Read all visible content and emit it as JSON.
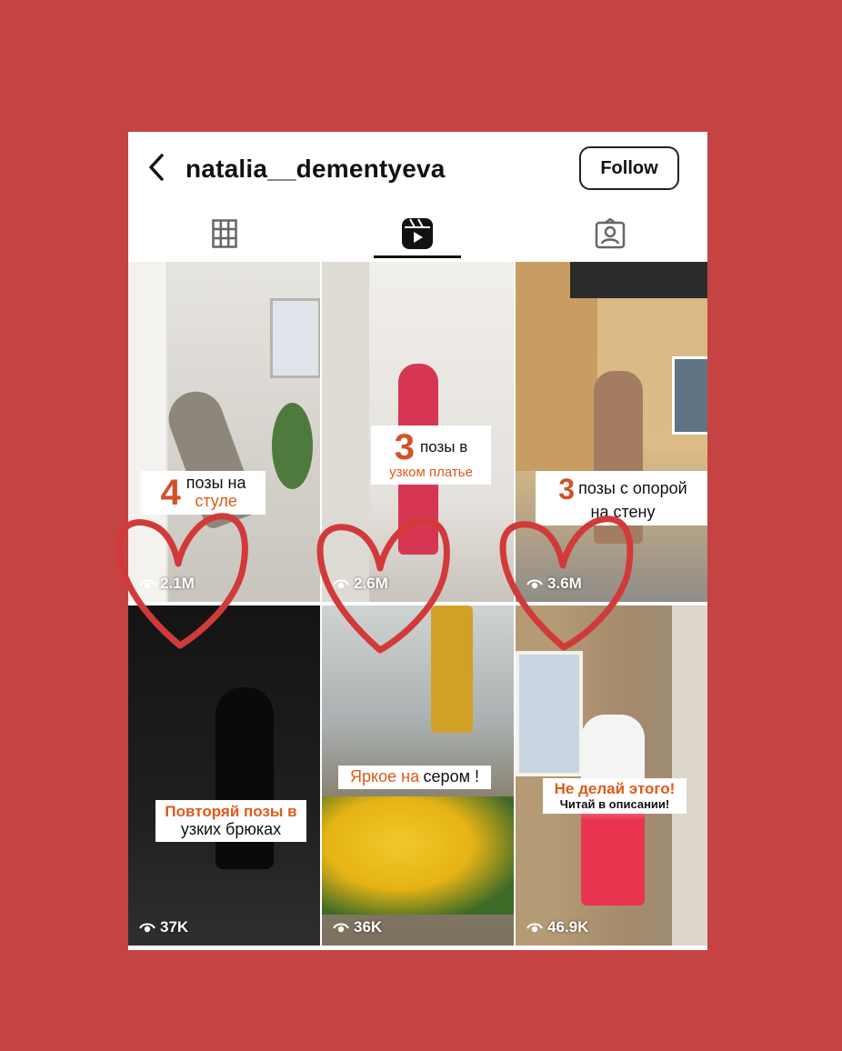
{
  "header": {
    "username": "natalia__dementyeva",
    "follow_label": "Follow"
  },
  "tabs": [
    {
      "name": "grid",
      "icon": "grid-icon"
    },
    {
      "name": "reels",
      "icon": "reels-icon",
      "active": true
    },
    {
      "name": "tagged",
      "icon": "tagged-person-icon"
    }
  ],
  "reels": [
    {
      "views": "2.1M",
      "caption_num": "4",
      "caption_line1": "позы на",
      "caption_line2": "стуле"
    },
    {
      "views": "2.6M",
      "caption_num": "3",
      "caption_line1": "позы в",
      "caption_line2": "узком платье"
    },
    {
      "views": "3.6M",
      "caption_num": "3",
      "caption_line1": "позы с опорой",
      "caption_line2": "на стену"
    },
    {
      "views": "37K",
      "caption_line1": "Повторяй позы в",
      "caption_line2": "узких брюках"
    },
    {
      "views": "36K",
      "caption_line1": "Яркое на",
      "caption_line2": "сером !"
    },
    {
      "views": "46.9K",
      "caption_line1": "Не делай этого!",
      "caption_line2": "Читай в описании!"
    }
  ],
  "colors": {
    "background": "#c54343",
    "accent_orange": "#e05a1a",
    "heart": "#d23a3a"
  }
}
